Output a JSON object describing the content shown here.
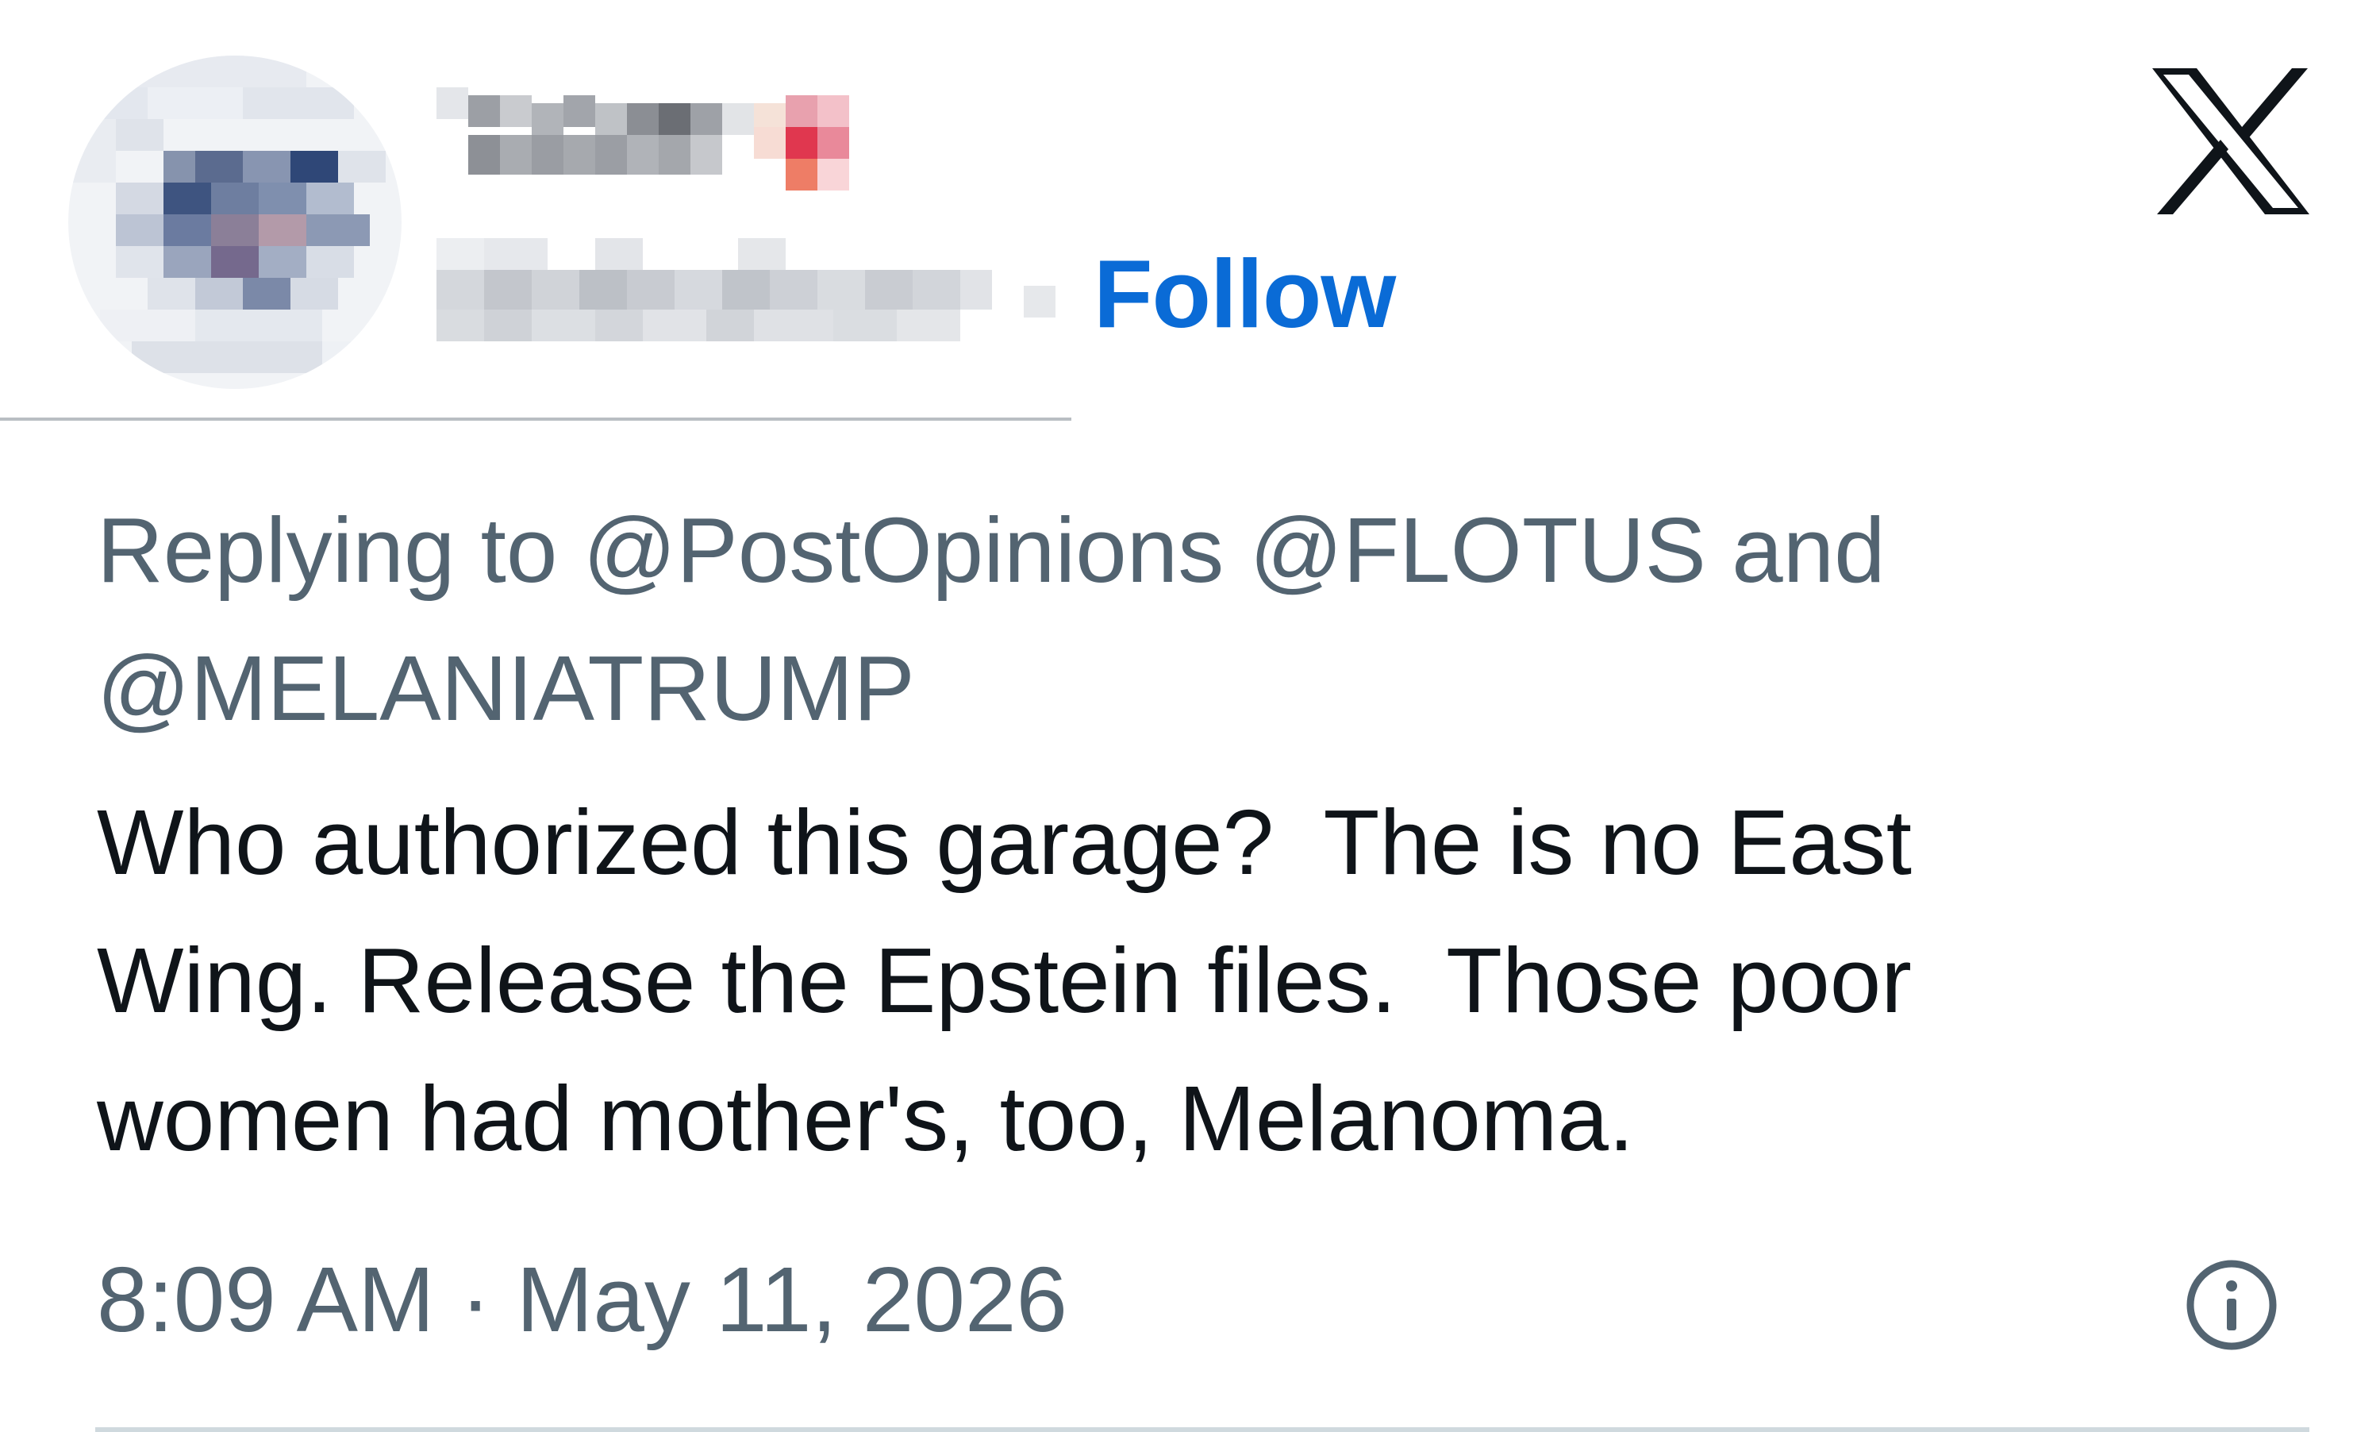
{
  "header": {
    "follow_label": "Follow"
  },
  "reply_context": {
    "prefix": "Replying to ",
    "mentions": [
      "@PostOpinions",
      "@FLOTUS"
    ],
    "conjunction": " and ",
    "last_mention": "@MELANIATRUMP"
  },
  "tweet": {
    "text": "Who authorized this garage?  The is no East Wing. Release the Epstein files.  Those poor women had mother's, too, Melanoma.",
    "line1": "Who authorized this garage?  The is no East",
    "line2": "Wing. Release the Epstein files.  Those poor",
    "line3": "women had mother's, too, Melanoma.",
    "timestamp": "8:09 AM · May 11, 2026"
  },
  "icons": {
    "avatar": "blurred-avatar",
    "logo": "x-logo-icon",
    "info": "info-icon"
  },
  "colors": {
    "follow": "#0a6bd6",
    "secondary_text": "#536471",
    "primary_text": "#0f1419",
    "divider": "#cfd9de"
  }
}
